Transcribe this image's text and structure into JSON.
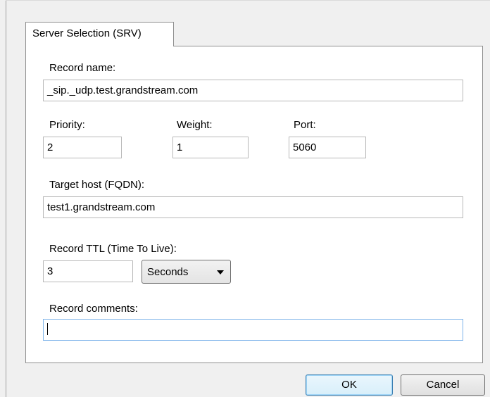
{
  "tab": {
    "label": "Server Selection (SRV)"
  },
  "record_name": {
    "label": "Record name:",
    "value": "_sip._udp.test.grandstream.com"
  },
  "priority": {
    "label": "Priority:",
    "value": "2"
  },
  "weight": {
    "label": "Weight:",
    "value": "1"
  },
  "port": {
    "label": "Port:",
    "value": "5060"
  },
  "target_host": {
    "label": "Target host (FQDN):",
    "value": "test1.grandstream.com"
  },
  "ttl": {
    "label": "Record TTL (Time To Live):",
    "value": "3",
    "unit_selected": "Seconds"
  },
  "comments": {
    "label": "Record comments:",
    "value": ""
  },
  "buttons": {
    "ok": "OK",
    "cancel": "Cancel"
  }
}
